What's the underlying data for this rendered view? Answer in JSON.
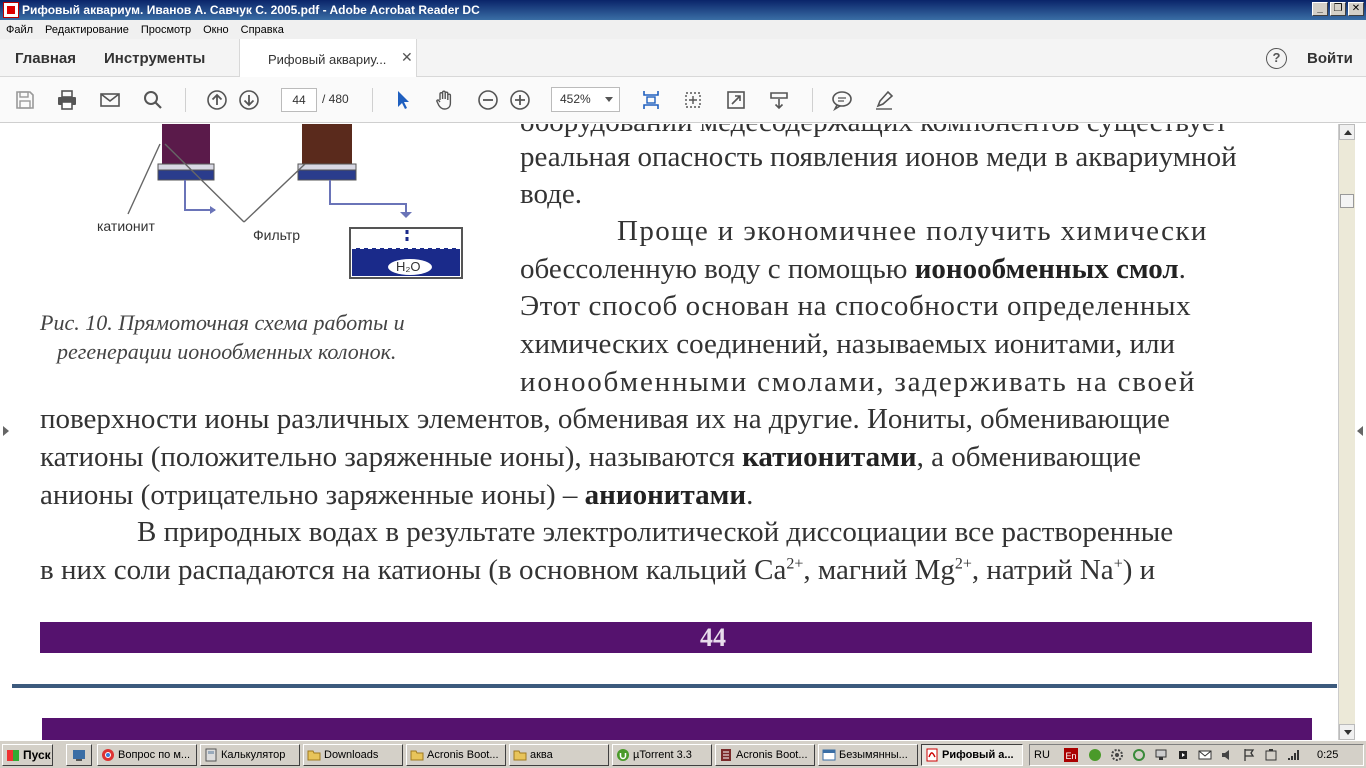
{
  "window": {
    "title": "Рифовый аквариум. Иванов А. Савчук С. 2005.pdf - Adobe Acrobat Reader DC",
    "controls": [
      "_",
      "❐",
      "✕"
    ]
  },
  "menu": [
    "Файл",
    "Редактирование",
    "Просмотр",
    "Окно",
    "Справка"
  ],
  "tabs": {
    "home": "Главная",
    "tools": "Инструменты",
    "document": "Рифовый аквариу...",
    "close": "✕",
    "help": "?",
    "login": "Войти"
  },
  "toolbar": {
    "page_current": "44",
    "page_total": "/ 480",
    "zoom": "452%"
  },
  "document": {
    "diagram": {
      "label_cationite": "катионит",
      "label_filter": "Фильтр",
      "label_water": "H₂O"
    },
    "caption_line1": "Рис. 10. Прямоточная схема работы и",
    "caption_line2": "регенерации ионообменных колонок.",
    "lines": {
      "l0": "оборудовании медесодержащих компонентов существует",
      "l1": "реальная опасность появления ионов меди в аквариумной",
      "l2": "воде.",
      "l3a": "Проще и экономичнее получить химически",
      "l4a": "обессоленную воду с помощью ",
      "l4b": "ионообменных смол",
      "l4c": ".",
      "l5": "Этот способ основан на способности определенных",
      "l6": "химических соединений, называемых ионитами, или",
      "l7": "ионообменными смолами, задерживать на своей",
      "l8": "поверхности ионы различных элементов, обменивая их на другие. Иониты, обменивающие",
      "l9a": "катионы (положительно заряженные ионы), называются ",
      "l9b": "катионитами",
      "l9c": ", а обменивающие",
      "l10a": "анионы (отрицательно заряженные ионы) – ",
      "l10b": "анионитами",
      "l10c": ".",
      "l11": "В природных водах в результате электролитической диссоциации все растворенные",
      "l12a": "в них соли распадаются на катионы (в основном кальций Ca",
      "l12b": "2+",
      "l12c": ", магний Mg",
      "l12d": "2+",
      "l12e": ", натрий  Na",
      "l12f": "+",
      "l12g": ") и"
    },
    "page_number": "44",
    "colors": {
      "band": "#55126e",
      "column_top": "#5a1a4a",
      "column_blue": "#2a3c8c"
    }
  },
  "taskbar": {
    "start": "Пуск",
    "items": [
      "Вопрос по м...",
      "Калькулятор",
      "Downloads",
      "Acronis Boot...",
      "аква",
      "µTorrent 3.3",
      "Acronis Boot...",
      "Безымянны...",
      "Рифовый а..."
    ],
    "lang": "RU",
    "clock": "0:25"
  }
}
